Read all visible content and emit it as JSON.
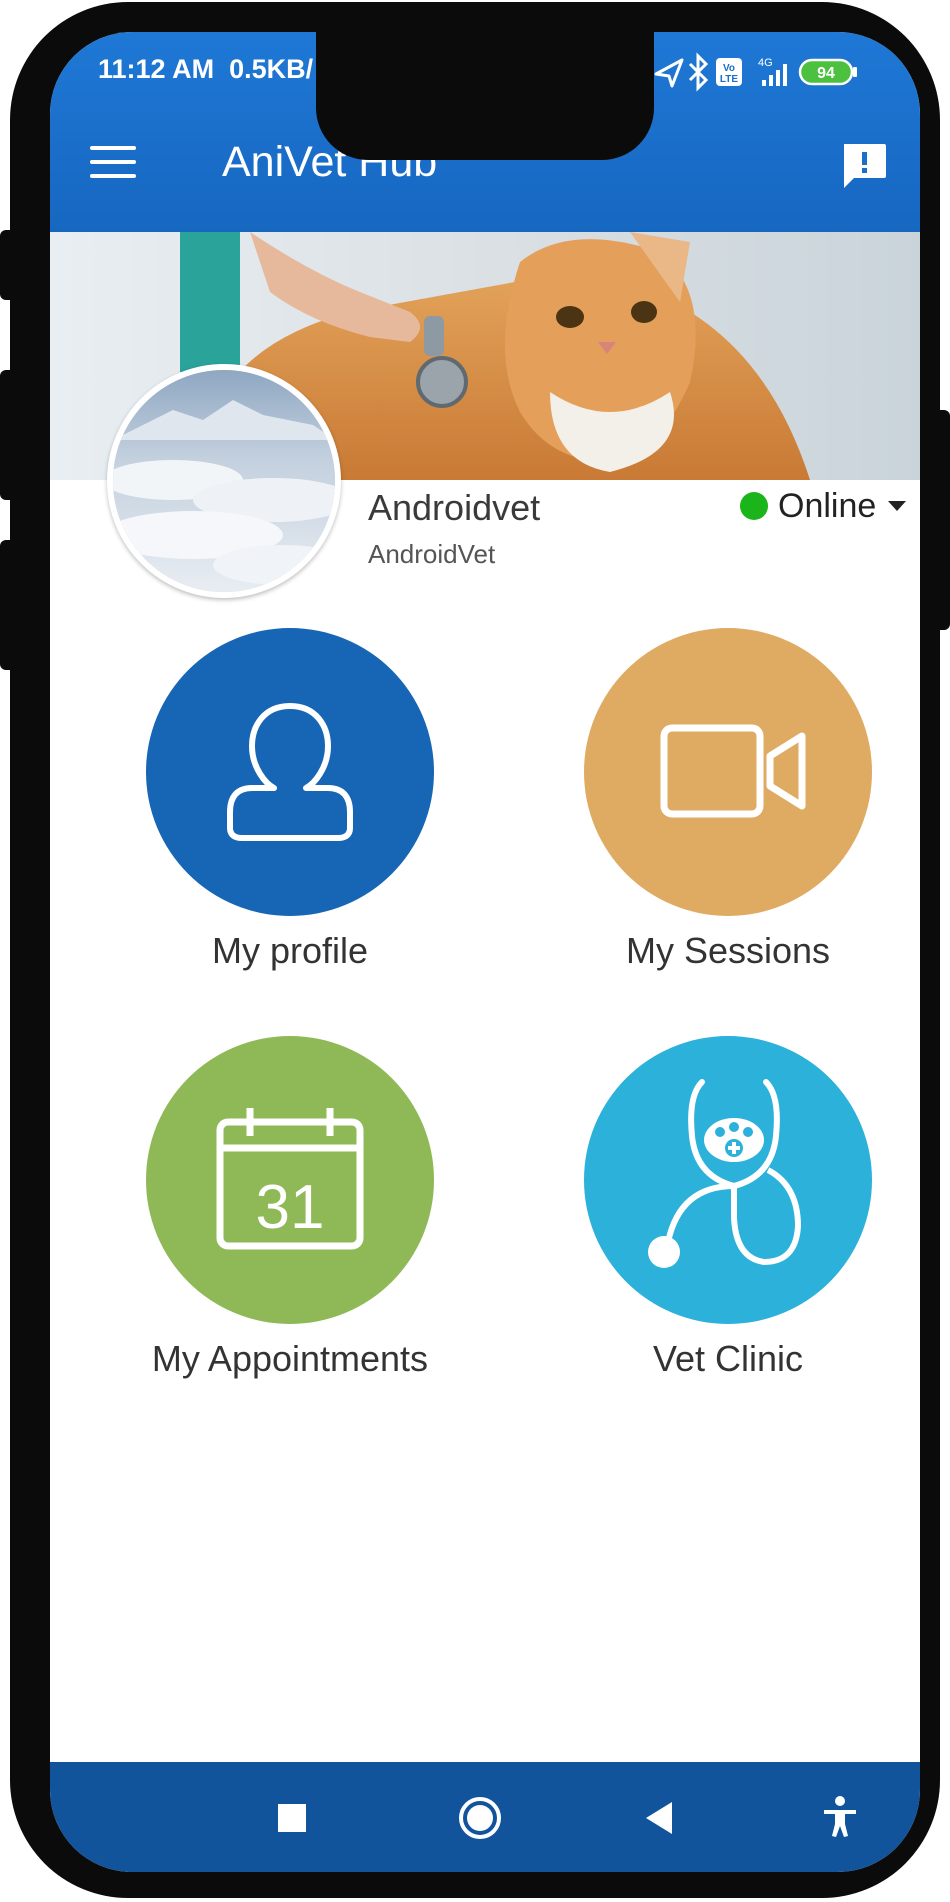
{
  "status_bar": {
    "time": "11:12 AM",
    "speed": "0.5KB/",
    "network": "4G",
    "volte": "Vo LTE",
    "battery": "94"
  },
  "app_bar": {
    "title": "AniVet Hub",
    "menu_icon": "hamburger-menu-icon",
    "action_icon": "feedback-icon"
  },
  "profile": {
    "name": "Androidvet",
    "username": "AndroidVet",
    "status": "Online",
    "status_color": "#1bb51b"
  },
  "tiles": [
    {
      "label": "My profile",
      "icon": "user-icon",
      "color": "#1666b5"
    },
    {
      "label": "My Sessions",
      "icon": "video-camera-icon",
      "color": "#dfab62"
    },
    {
      "label": "My Appointments",
      "icon": "calendar-icon",
      "color": "#8fb957",
      "calendar_day": "31"
    },
    {
      "label": "Vet Clinic",
      "icon": "stethoscope-paw-icon",
      "color": "#2bb1da"
    }
  ],
  "nav_bar": {
    "buttons": [
      "recents-icon",
      "home-icon",
      "back-icon",
      "accessibility-icon"
    ]
  },
  "colors": {
    "app_bar": "#1a6fcb",
    "nav_bar": "#12549c"
  }
}
